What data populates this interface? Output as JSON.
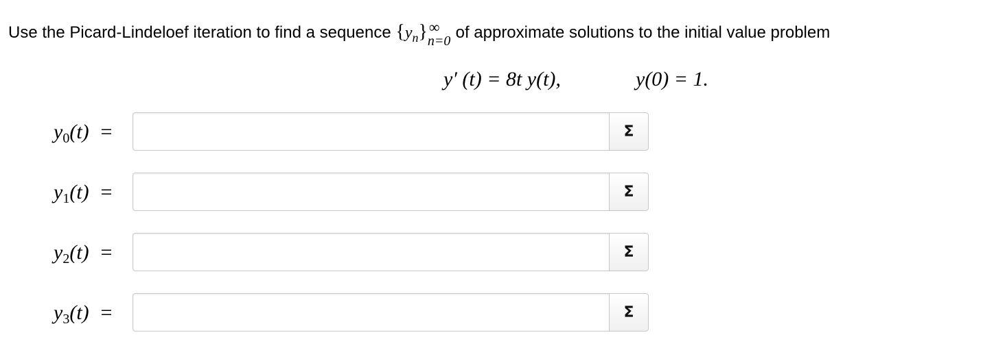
{
  "prompt": {
    "before": "Use the Picard-Lindeloef iteration to find a sequence ",
    "brace_open": "{",
    "seq_var": "y",
    "seq_sub": "n",
    "brace_close": "}",
    "sup": "∞",
    "sub": "n=0",
    "after": " of approximate solutions to the initial value problem"
  },
  "equation": {
    "ode": "y′ (t) = 8t y(t),",
    "initial": "y(0) = 1."
  },
  "rows": [
    {
      "var": "y",
      "sub": "0",
      "rest": "(t)  =",
      "value": "",
      "button_label": "Σ"
    },
    {
      "var": "y",
      "sub": "1",
      "rest": "(t)  =",
      "value": "",
      "button_label": "Σ"
    },
    {
      "var": "y",
      "sub": "2",
      "rest": "(t)  =",
      "value": "",
      "button_label": "Σ"
    },
    {
      "var": "y",
      "sub": "3",
      "rest": "(t)  =",
      "value": "",
      "button_label": "Σ"
    }
  ]
}
